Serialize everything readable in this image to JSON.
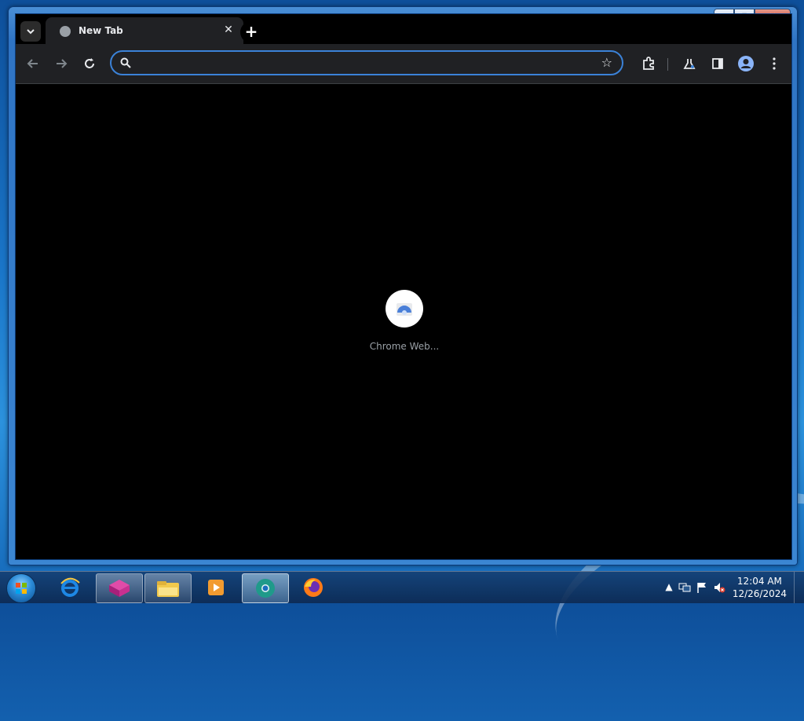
{
  "browser": {
    "tab": {
      "title": "New Tab",
      "close_symbol": "✕"
    },
    "new_tab_symbol": "+",
    "omnibox": {
      "value": "",
      "placeholder": ""
    },
    "shortcuts": [
      {
        "label": "Chrome Web..."
      }
    ],
    "accent_color": "#3b82d8"
  },
  "window_controls": {
    "minimize": "▁",
    "maximize": "▢",
    "close": "✕"
  },
  "taskbar": {
    "apps": [
      {
        "name": "internet-explorer-icon"
      },
      {
        "name": "app-cube-icon"
      },
      {
        "name": "file-explorer-icon"
      },
      {
        "name": "media-player-icon"
      },
      {
        "name": "chrome-icon"
      },
      {
        "name": "firefox-icon"
      }
    ],
    "clock": {
      "time": "12:04 AM",
      "date": "12/26/2024"
    }
  }
}
